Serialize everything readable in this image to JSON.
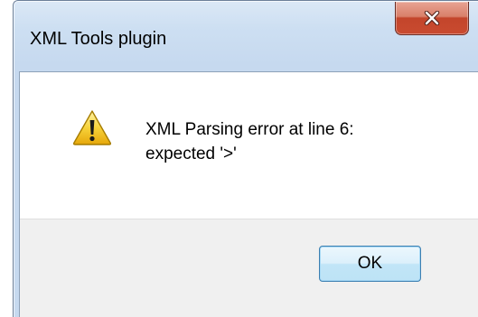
{
  "dialog": {
    "title": "XML Tools plugin",
    "icon": "warning-icon",
    "message_lines": [
      "XML Parsing error at line 6:",
      "expected '>'"
    ],
    "ok_label": "OK",
    "close_glyph": "x"
  },
  "colors": {
    "close_button": "#c94b30",
    "warning_yellow": "#f7d23a",
    "ok_border": "#3c7fb1"
  }
}
